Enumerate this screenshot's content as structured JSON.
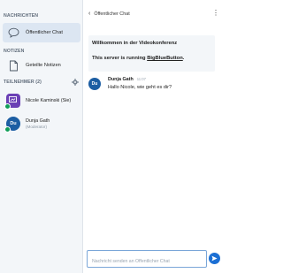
{
  "sidebar": {
    "messages_title": "NACHRICHTEN",
    "public_chat_label": "Öffentlicher Chat",
    "notes_title": "NOTIZEN",
    "shared_notes_label": "Geteilte Notizen",
    "participants_title": "TEILNEHMER (2)",
    "users": [
      {
        "initials": "",
        "name": "Nicole Kaminski (Sie)",
        "status": "",
        "avatar_color": "#6a3fb5"
      },
      {
        "initials": "Du",
        "name": "Dunja Gath",
        "status": "(Moderator)",
        "avatar_color": "#1c5ea3"
      }
    ]
  },
  "chat": {
    "header_title": "Öffentlicher Chat",
    "welcome_title": "Willkommen in der Videokonferenz",
    "welcome_server_prefix": "This server is running ",
    "welcome_server_link": "BigBlueButton",
    "welcome_server_suffix": ".",
    "messages": [
      {
        "initials": "Du",
        "sender": "Dunja Gath",
        "time": "11:07",
        "text": "Hallo Nicole, wie geht es dir?"
      }
    ],
    "input_placeholder": "Nachricht senden an Öffentlicher Chat",
    "input_value": ""
  },
  "colors": {
    "accent": "#1b6fd4",
    "sidebar_bg": "#f3f6f9",
    "active_bg": "#dce6f2",
    "online": "#0f9d58"
  },
  "icons": {
    "public_chat": "chat-bubble-icon",
    "shared_notes": "document-icon",
    "settings": "gear-icon",
    "back": "chevron-left-icon",
    "menu": "kebab-menu-icon",
    "send": "send-icon",
    "presenter": "presenter-icon"
  }
}
